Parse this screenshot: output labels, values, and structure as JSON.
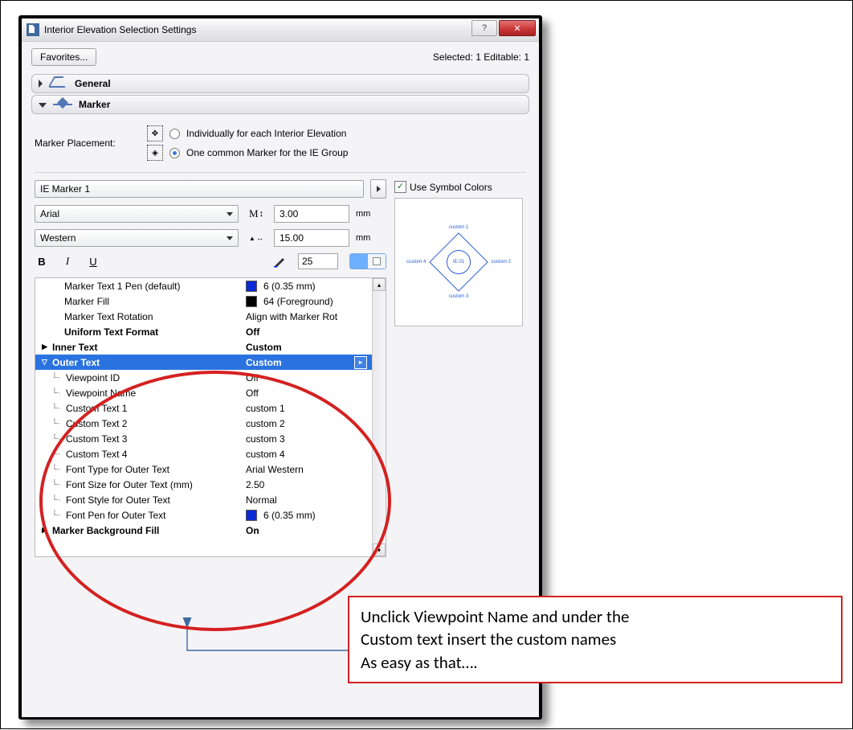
{
  "window": {
    "title": "Interior Elevation Selection Settings"
  },
  "topbar": {
    "favorites_label": "Favorites...",
    "status": "Selected: 1 Editable: 1"
  },
  "sections": {
    "general_label": "General",
    "marker_label": "Marker"
  },
  "placement": {
    "label": "Marker Placement:",
    "opt1": "Individually for each Interior Elevation",
    "opt2": "One common Marker for the IE Group"
  },
  "marker_select": {
    "name": "IE Marker 1"
  },
  "use_symbol_colors_label": "Use Symbol Colors",
  "font": {
    "family": "Arial",
    "script": "Western"
  },
  "sizes": {
    "text_mm": "3.00",
    "marker_mm": "15.00",
    "unit": "mm"
  },
  "pen_number": "25",
  "preview": {
    "center": "IE-01",
    "top": "custom 1",
    "right": "custom 2",
    "bottom": "custom 3",
    "left": "custom 4"
  },
  "tree": {
    "r1_key": "Marker Text 1 Pen (default)",
    "r1_val": "6 (0.35 mm)",
    "r2_key": "Marker Fill",
    "r2_val": "64 (Foreground)",
    "r3_key": "Marker Text Rotation",
    "r3_val": "Align with Marker Rot",
    "r4_key": "Uniform Text Format",
    "r4_val": "Off",
    "r5_key": "Inner Text",
    "r5_val": "Custom",
    "r6_key": "Outer Text",
    "r6_val": "Custom",
    "r7_key": "Viewpoint ID",
    "r7_val": "Off",
    "r8_key": "Viewpoint Name",
    "r8_val": "Off",
    "r9_key": "Custom Text 1",
    "r9_val": "custom 1",
    "r10_key": "Custom Text 2",
    "r10_val": "custom 2",
    "r11_key": "Custom Text 3",
    "r11_val": "custom 3",
    "r12_key": "Custom Text 4",
    "r12_val": "custom 4",
    "r13_key": "Font Type for Outer Text",
    "r13_val": "Arial Western",
    "r14_key": "Font Size for Outer Text (mm)",
    "r14_val": "2.50",
    "r15_key": "Font Style for Outer Text",
    "r15_val": "Normal",
    "r16_key": "Font Pen for Outer Text",
    "r16_val": "6 (0.35 mm)",
    "r17_key": "Marker Background Fill",
    "r17_val": "On"
  },
  "callout": {
    "line1": "Unclick Viewpoint Name and under the",
    "line2": "Custom text insert the custom names",
    "line3": "As easy as that…."
  }
}
